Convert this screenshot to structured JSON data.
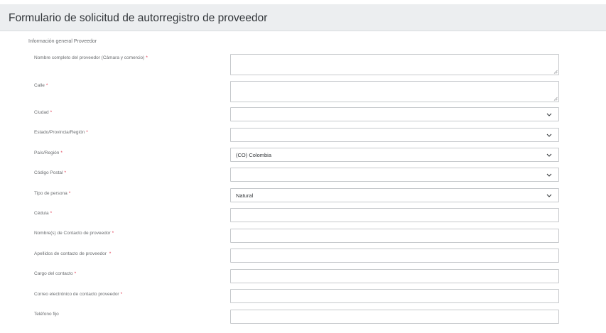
{
  "page": {
    "title": "Formulario de solicitud de autorregistro de proveedor"
  },
  "section": {
    "title": "Información general Proveedor"
  },
  "fields": [
    {
      "label": "Nombre completo del proveedor  (Cámara y comercio)",
      "required": "*",
      "type": "textarea",
      "value": ""
    },
    {
      "label": "Calle",
      "required": "*",
      "type": "textarea",
      "value": ""
    },
    {
      "label": "Ciudad",
      "required": "*",
      "type": "select",
      "value": ""
    },
    {
      "label": "Estado/Provincia/Región",
      "required": "*",
      "type": "select",
      "value": ""
    },
    {
      "label": "País/Región",
      "required": "*",
      "type": "select",
      "value": "(CO) Colombia"
    },
    {
      "label": "Código Postal",
      "required": "*",
      "type": "select",
      "value": ""
    },
    {
      "label": "Tipo de persona",
      "required": "*",
      "type": "select",
      "value": "Natural"
    },
    {
      "label": "Cédula",
      "required": "*",
      "type": "text",
      "value": ""
    },
    {
      "label": "Nombre(s) de Contacto de proveedor",
      "required": "*",
      "type": "text",
      "value": ""
    },
    {
      "label": "Apellidos de contacto de proveedor ",
      "required": "*",
      "type": "text",
      "value": ""
    },
    {
      "label": "Cargo del contacto",
      "required": "*",
      "type": "text",
      "value": ""
    },
    {
      "label": "Correo electrónico de contacto proveedor",
      "required": "*",
      "type": "text",
      "value": ""
    },
    {
      "label": "Teléfono fijo",
      "required": "",
      "type": "text",
      "value": ""
    }
  ],
  "icons": {
    "dropdown": "chevron-down-icon",
    "resize": "resize-grip-icon"
  }
}
